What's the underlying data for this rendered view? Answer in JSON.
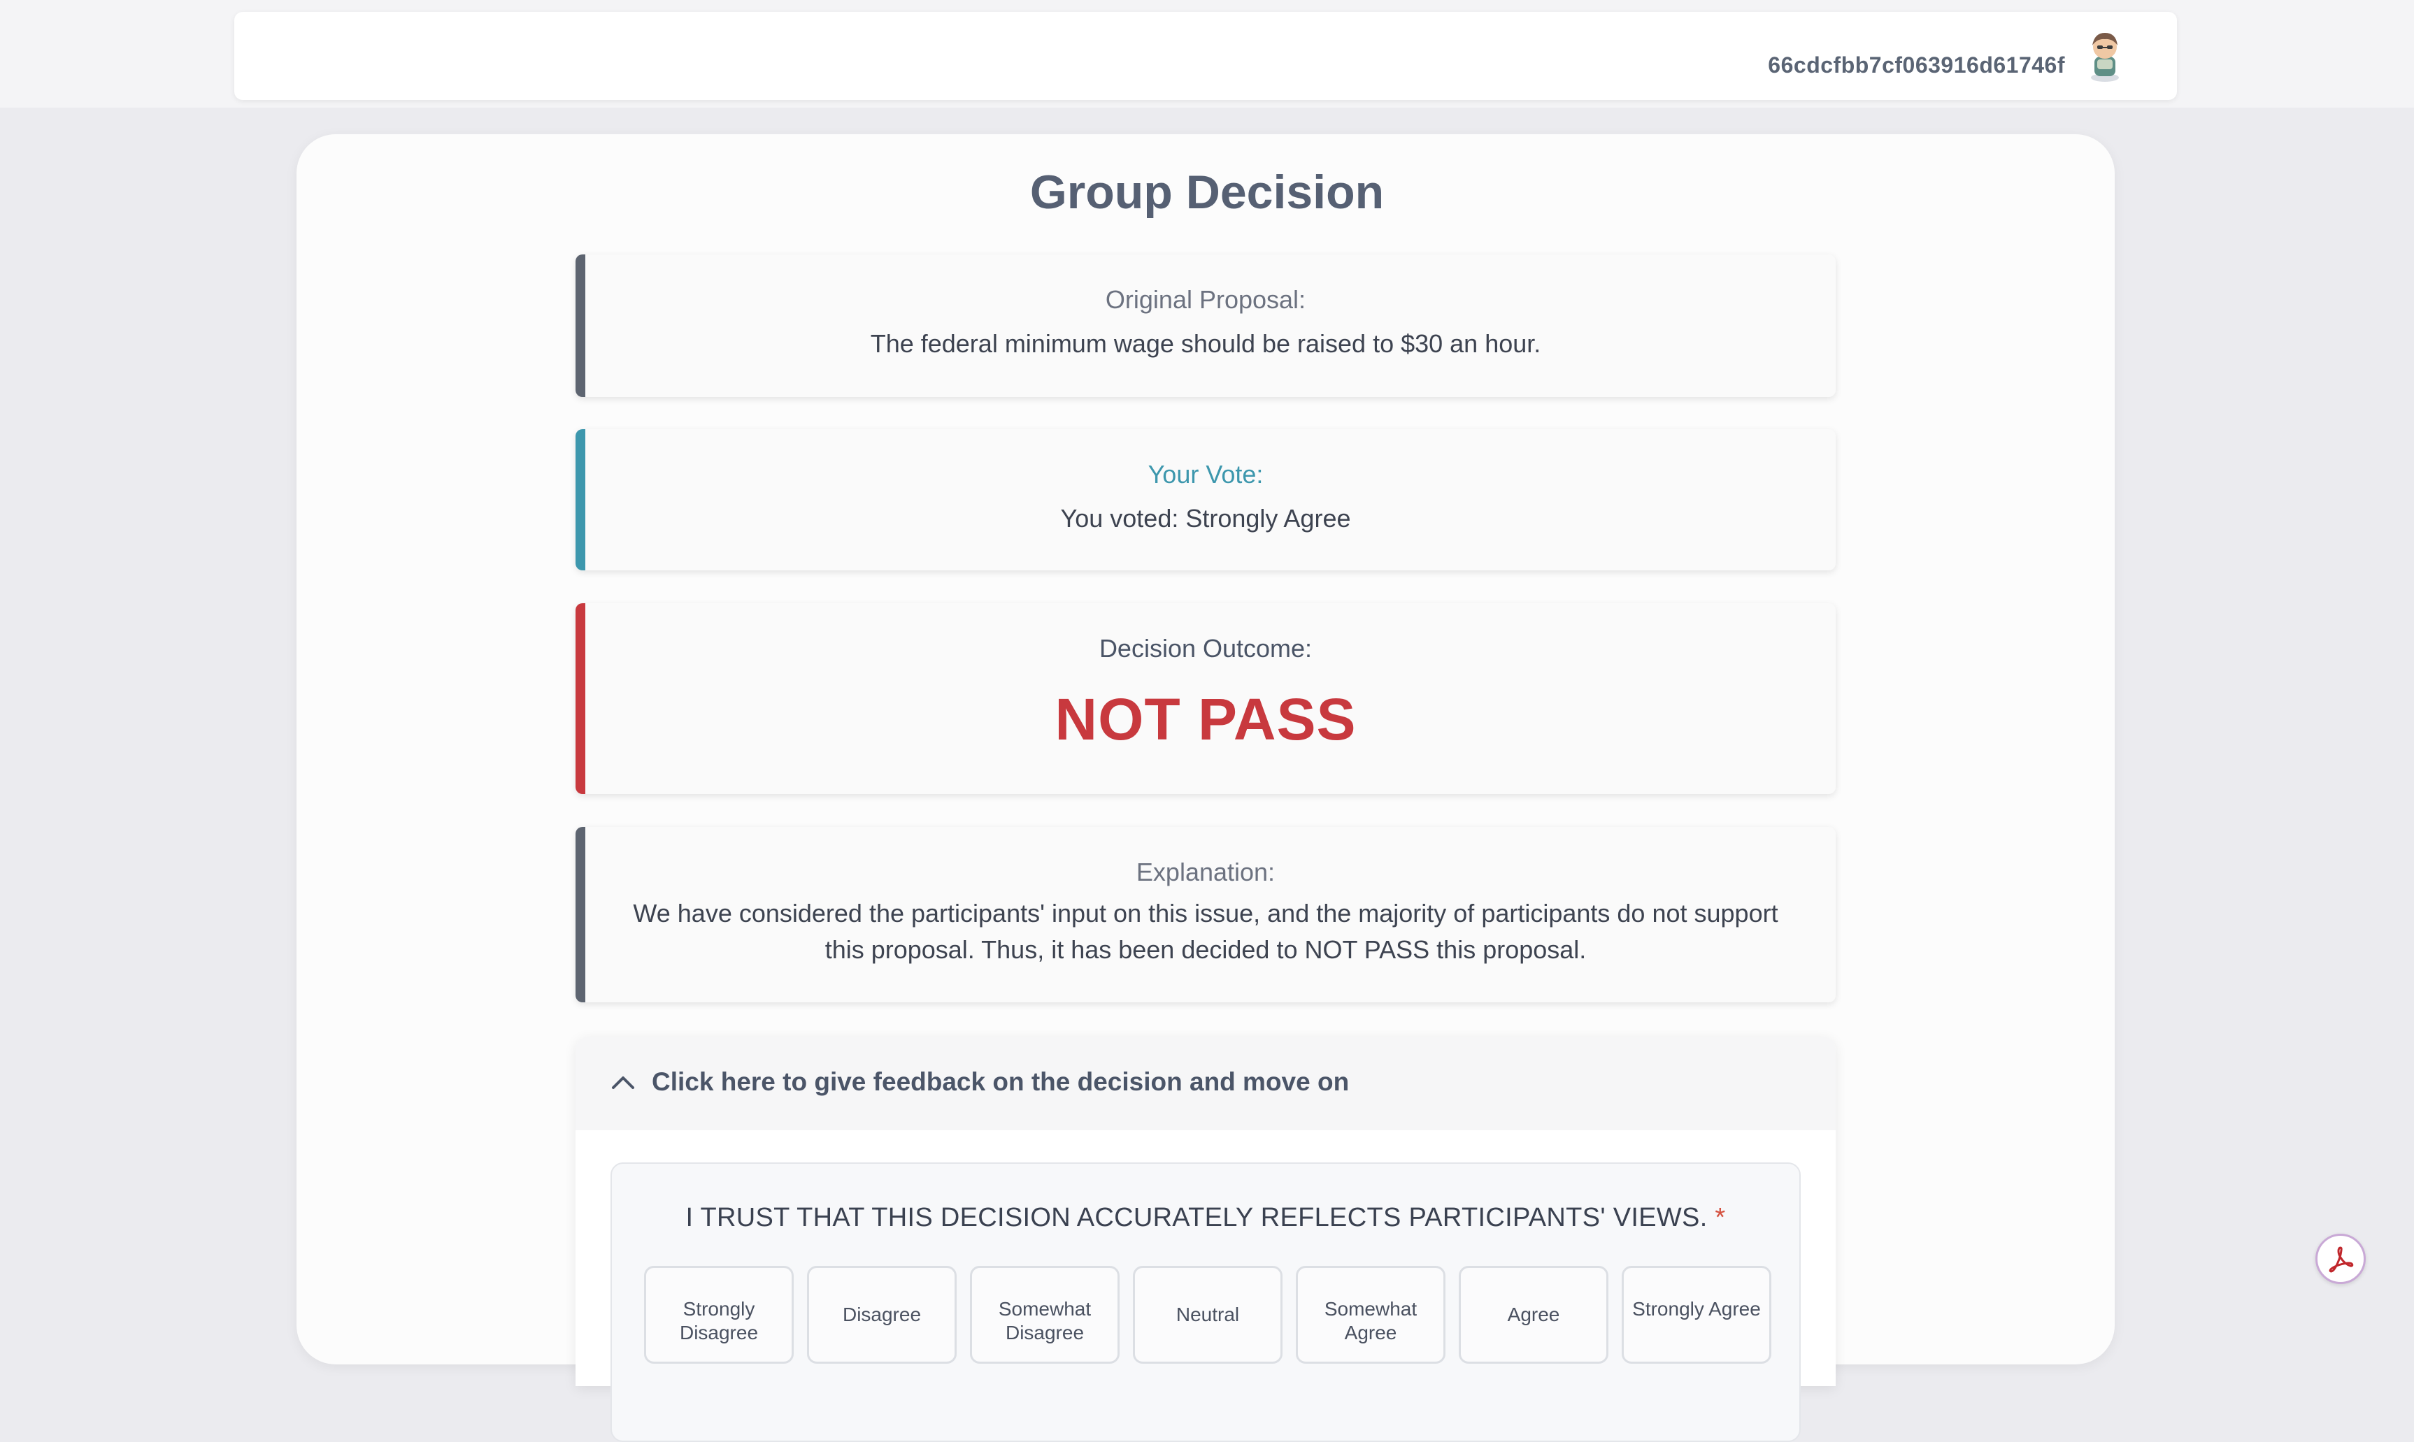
{
  "header": {
    "user_id": "66cdcfbb7cf063916d61746f",
    "avatar_icon": "avatar-character-icon"
  },
  "page": {
    "title": "Group Decision"
  },
  "proposal": {
    "label": "Original Proposal:",
    "text": "The federal minimum wage should be raised to $30 an hour.",
    "accent_color": "#5d6470"
  },
  "vote": {
    "label": "Your Vote:",
    "text": "You voted: Strongly Agree",
    "accent_color": "#3d97ad"
  },
  "outcome": {
    "label": "Decision Outcome:",
    "value": "NOT PASS",
    "accent_color": "#c8393e"
  },
  "explanation": {
    "label": "Explanation:",
    "text": "We have considered the participants' input on this issue, and the majority of participants do not support this proposal. Thus, it has been decided to NOT PASS this proposal.",
    "accent_color": "#5d6470"
  },
  "feedback": {
    "toggle_label": "Click here to give feedback on the decision and move on",
    "question": "I TRUST THAT THIS DECISION ACCURATELY REFLECTS PARTICIPANTS' VIEWS.",
    "required_mark": "*",
    "options": [
      "Strongly Disagree",
      "Disagree",
      "Somewhat Disagree",
      "Neutral",
      "Somewhat Agree",
      "Agree",
      "Strongly Agree"
    ]
  },
  "floating": {
    "pdf_icon": "pdf-icon"
  }
}
